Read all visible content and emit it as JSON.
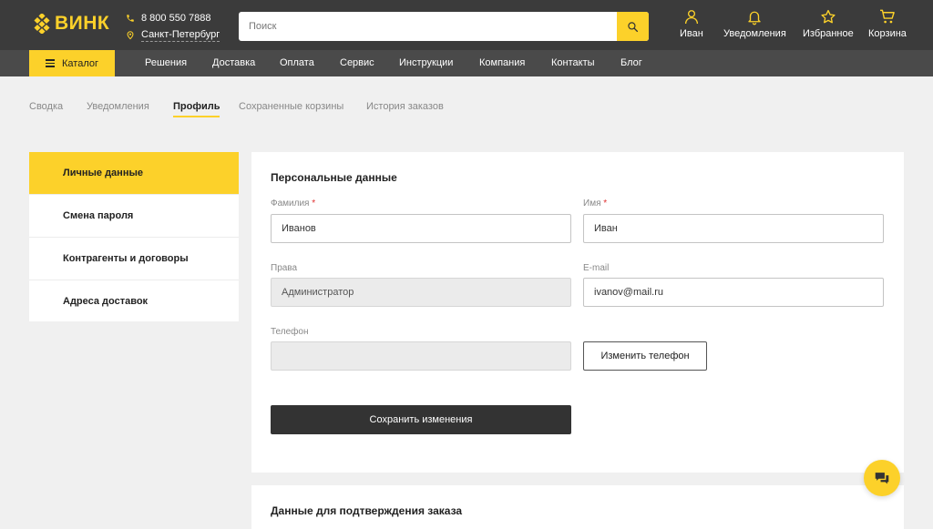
{
  "colors": {
    "accent": "#fcd12a",
    "header_bg": "#3b3b3b",
    "nav_bg": "#4a4a4a"
  },
  "header": {
    "logo_text": "ВИНК",
    "phone": "8 800 550 7888",
    "city": "Санкт-Петербург",
    "search_placeholder": "Поиск",
    "icons": [
      {
        "name": "user-icon",
        "label": "Иван"
      },
      {
        "name": "bell-icon",
        "label": "Уведомления"
      },
      {
        "name": "star-icon",
        "label": "Избранное"
      },
      {
        "name": "cart-icon",
        "label": "Корзина"
      }
    ]
  },
  "nav": {
    "catalog_label": "Каталог",
    "links": [
      "Решения",
      "Доставка",
      "Оплата",
      "Сервис",
      "Инструкции",
      "Компания",
      "Контакты",
      "Блог"
    ]
  },
  "tabs": [
    {
      "label": "Сводка",
      "active": false
    },
    {
      "label": "Уведомления",
      "active": false
    },
    {
      "label": "Профиль",
      "active": true
    },
    {
      "label": "Сохраненные корзины",
      "active": false
    },
    {
      "label": "История заказов",
      "active": false
    }
  ],
  "side_menu": [
    {
      "label": "Личные данные",
      "active": true
    },
    {
      "label": "Смена пароля",
      "active": false
    },
    {
      "label": "Контрагенты и договоры",
      "active": false
    },
    {
      "label": "Адреса доставок",
      "active": false
    }
  ],
  "form": {
    "title": "Персональные данные",
    "surname": {
      "label": "Фамилия",
      "required_mark": "*",
      "value": "Иванов"
    },
    "name": {
      "label": "Имя",
      "required_mark": "*",
      "value": "Иван"
    },
    "rights": {
      "label": "Права",
      "value": "Администратор"
    },
    "email": {
      "label": "E-mail",
      "value": "ivanov@mail.ru"
    },
    "phone": {
      "label": "Телефон",
      "value": ""
    },
    "change_phone_label": "Изменить телефон",
    "save_label": "Сохранить изменения"
  },
  "confirm_section": {
    "title": "Данные для подтверждения заказа"
  }
}
